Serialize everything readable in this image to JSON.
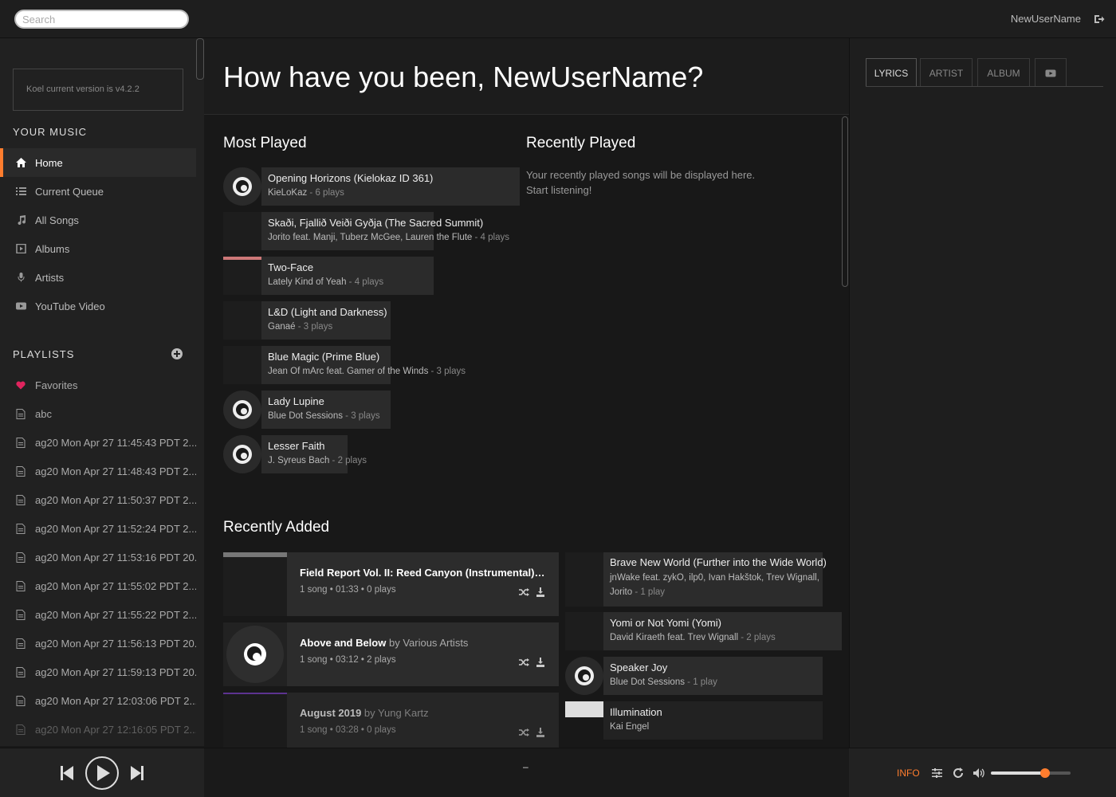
{
  "topbar": {
    "search_placeholder": "Search",
    "username": "NewUserName"
  },
  "sidebar": {
    "version_text": "Koel current version is v4.2.2",
    "your_music_heading": "YOUR MUSIC",
    "nav": [
      {
        "label": "Home",
        "icon": "home-icon",
        "active": true
      },
      {
        "label": "Current Queue",
        "icon": "queue-icon"
      },
      {
        "label": "All Songs",
        "icon": "music-note-icon"
      },
      {
        "label": "Albums",
        "icon": "album-icon"
      },
      {
        "label": "Artists",
        "icon": "microphone-icon"
      },
      {
        "label": "YouTube Video",
        "icon": "youtube-icon"
      }
    ],
    "playlists_heading": "PLAYLISTS",
    "playlists": [
      {
        "label": "Favorites",
        "icon": "heart-icon"
      },
      {
        "label": "abc",
        "icon": "file-icon"
      },
      {
        "label": "ag20 Mon Apr 27 11:45:43 PDT 2...",
        "icon": "file-icon"
      },
      {
        "label": "ag20 Mon Apr 27 11:48:43 PDT 2...",
        "icon": "file-icon"
      },
      {
        "label": "ag20 Mon Apr 27 11:50:37 PDT 2...",
        "icon": "file-icon"
      },
      {
        "label": "ag20 Mon Apr 27 11:52:24 PDT 2...",
        "icon": "file-icon"
      },
      {
        "label": "ag20 Mon Apr 27 11:53:16 PDT 20...",
        "icon": "file-icon"
      },
      {
        "label": "ag20 Mon Apr 27 11:55:02 PDT 2...",
        "icon": "file-icon"
      },
      {
        "label": "ag20 Mon Apr 27 11:55:22 PDT 2...",
        "icon": "file-icon"
      },
      {
        "label": "ag20 Mon Apr 27 11:56:13 PDT 20...",
        "icon": "file-icon"
      },
      {
        "label": "ag20 Mon Apr 27 11:59:13 PDT 20...",
        "icon": "file-icon"
      },
      {
        "label": "ag20 Mon Apr 27 12:03:06 PDT 2...",
        "icon": "file-icon"
      },
      {
        "label": "ag20 Mon Apr 27 12:16:05 PDT 2...",
        "icon": "file-icon"
      }
    ]
  },
  "main": {
    "greeting": "How have you been, NewUserName?",
    "most_played_heading": "Most Played",
    "recently_played_heading": "Recently Played",
    "recently_played_empty_line1": "Your recently played songs will be displayed here.",
    "recently_played_empty_line2": "Start listening!",
    "most_played": [
      {
        "title": "Opening Horizons (Kielokaz ID 361)",
        "artist": "KieLoKaz",
        "plays": " - 6 plays"
      },
      {
        "title": "Skaði, Fjallið Veiði Gyðja (The Sacred Summit)",
        "artist": "Jorito feat. Manji, Tuberz McGee, Lauren the Flute",
        "plays": " - 4 plays"
      },
      {
        "title": "Two-Face",
        "artist": "Lately Kind of Yeah",
        "plays": " - 4 plays"
      },
      {
        "title": "L&D (Light and Darkness)",
        "artist": "Ganaé",
        "plays": " - 3 plays"
      },
      {
        "title": "Blue Magic (Prime Blue)",
        "artist": "Jean Of mArc feat. Gamer of the Winds",
        "plays": " - 3 plays"
      },
      {
        "title": "Lady Lupine",
        "artist": "Blue Dot Sessions",
        "plays": " - 3 plays"
      },
      {
        "title": "Lesser Faith",
        "artist": "J. Syreus Bach",
        "plays": " - 2 plays"
      }
    ],
    "recently_added_heading": "Recently Added",
    "recently_added_albums": [
      {
        "title": "Field Report Vol. II: Reed Canyon (Instrumental)",
        "by": " by ...",
        "meta": "1 song • 01:33 • 0 plays"
      },
      {
        "title": "Above and Below",
        "by": " by Various Artists",
        "meta": "1 song • 03:12 • 2 plays"
      },
      {
        "title": "August 2019",
        "by": " by Yung Kartz",
        "meta": "1 song • 03:28 • 0 plays"
      }
    ],
    "recently_added_songs": [
      {
        "title": "Brave New World (Further into the Wide World)",
        "artist_line1": "jnWake feat. zykO, ilp0, Ivan Hakštok, Trev Wignall,",
        "artist_line2": "Jorito",
        "plays": " - 1 play"
      },
      {
        "title": "Yomi or Not Yomi (Yomi)",
        "artist": "David Kiraeth feat. Trev Wignall",
        "plays": " - 2 plays"
      },
      {
        "title": "Speaker Joy",
        "artist": "Blue Dot Sessions",
        "plays": " - 1 play"
      },
      {
        "title": "Illumination",
        "artist": "Kai Engel",
        "plays": ""
      }
    ]
  },
  "right_panel": {
    "tabs": [
      {
        "label": "LYRICS",
        "active": true
      },
      {
        "label": "ARTIST"
      },
      {
        "label": "ALBUM"
      },
      {
        "label": "",
        "icon": "youtube-icon"
      }
    ]
  },
  "footer": {
    "progress_placeholder": "–",
    "info_label": "INFO",
    "volume_level": 0.68,
    "accent_color": "#ff7d2e"
  }
}
